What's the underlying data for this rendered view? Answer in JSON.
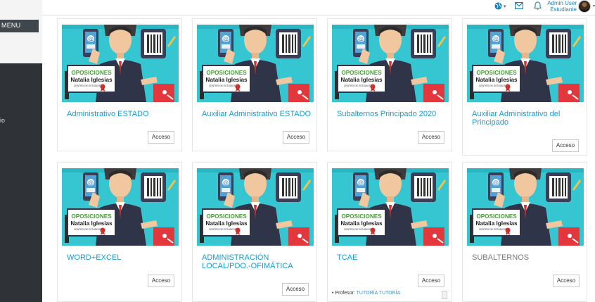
{
  "sidebar": {
    "menu_label": "MENU",
    "item_text": "io"
  },
  "header": {
    "user_name": "Admin User",
    "user_role": "Estudiante",
    "globe_icon": "globe-icon",
    "mail_icon": "mail-icon",
    "bell_icon": "bell-icon"
  },
  "logo": {
    "line1": "OPOSICIONES",
    "line2": "Natalia Iglesias",
    "line3": "CENTRO DE ESTUDIOS"
  },
  "cards": [
    {
      "title": "Administrativo ESTADO",
      "button": "Acceso"
    },
    {
      "title": "Auxiliar Administrativo ESTADO",
      "button": "Acceso"
    },
    {
      "title": "Subalternos Principado 2020",
      "button": "Acceso"
    },
    {
      "title": "Auxiliar Administrativo del Principado",
      "button": "Acceso"
    },
    {
      "title": "WORD+EXCEL",
      "button": "Acceso"
    },
    {
      "title": "ADMINISTRACIÓN LOCAL/PDO.-OFIMÁTICA",
      "button": "Acceso"
    },
    {
      "title": "TCAE",
      "button": "Acceso",
      "teacher_label": "Profesor:",
      "teacher_name": "TUTORÍA TUTORÍA"
    },
    {
      "title": "SUBALTERNOS",
      "button": "Acceso"
    }
  ],
  "colors": {
    "accent": "#1b9bd3",
    "sidebar_dark": "#2f3337",
    "image_bg": "#35c6d2"
  }
}
